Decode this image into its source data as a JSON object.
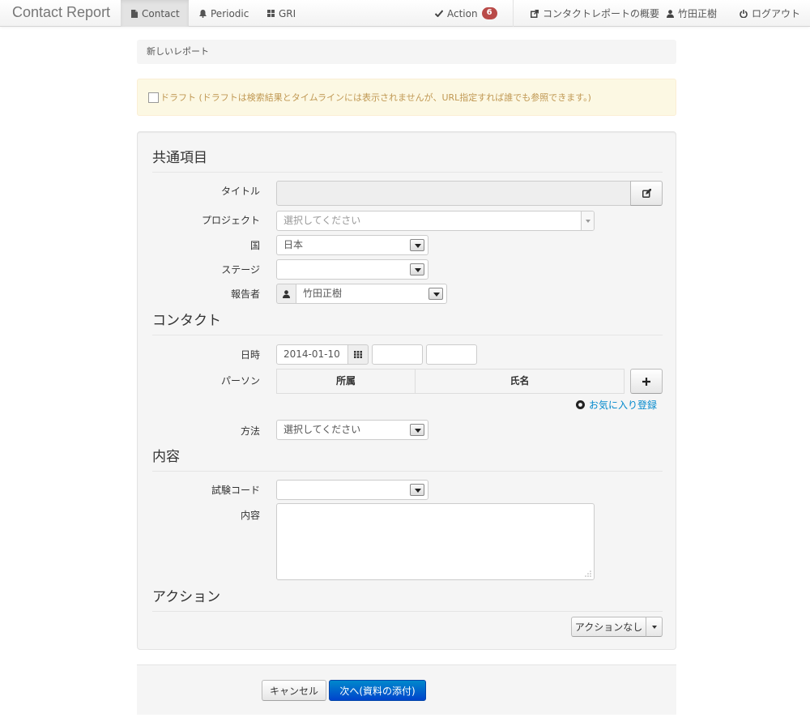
{
  "navbar": {
    "brand": "Contact Report",
    "items": [
      {
        "label": "Contact",
        "icon": "document-icon"
      },
      {
        "label": "Periodic",
        "icon": "bell-icon"
      },
      {
        "label": "GRI",
        "icon": "grid-icon"
      }
    ],
    "action": {
      "label": "Action",
      "badge": "6"
    },
    "overview": "コンタクトレポートの概要",
    "user": "竹田正樹",
    "logout": "ログアウト"
  },
  "breadcrumb": "新しいレポート",
  "draft_notice": "ドラフト (ドラフトは検索結果とタイムラインには表示されませんが、URL指定すれば誰でも参照できます。)",
  "sections": {
    "common": "共通項目",
    "contact": "コンタクト",
    "content": "内容",
    "action": "アクション"
  },
  "fields": {
    "title": {
      "label": "タイトル",
      "value": ""
    },
    "project": {
      "label": "プロジェクト",
      "placeholder": "選択してください"
    },
    "country": {
      "label": "国",
      "value": "日本"
    },
    "stage": {
      "label": "ステージ",
      "value": ""
    },
    "reporter": {
      "label": "報告者",
      "value": "竹田正樹"
    },
    "datetime": {
      "label": "日時",
      "date": "2014-01-10",
      "hour": "",
      "minute": ""
    },
    "person": {
      "label": "パーソン",
      "columns": [
        "所属",
        "氏名"
      ]
    },
    "favorite_link": "お気に入り登録",
    "method": {
      "label": "方法",
      "value": "選択してください"
    },
    "test_code": {
      "label": "試験コード",
      "value": ""
    },
    "body": {
      "label": "内容",
      "value": ""
    }
  },
  "action_button": "アクションなし",
  "footer": {
    "cancel": "キャンセル",
    "next": "次へ(資料の添付)"
  },
  "colors": {
    "primary": "#0088cc",
    "badge": "#b94a48",
    "alert_text": "#c09853",
    "alert_bg": "#fcf8e3"
  }
}
